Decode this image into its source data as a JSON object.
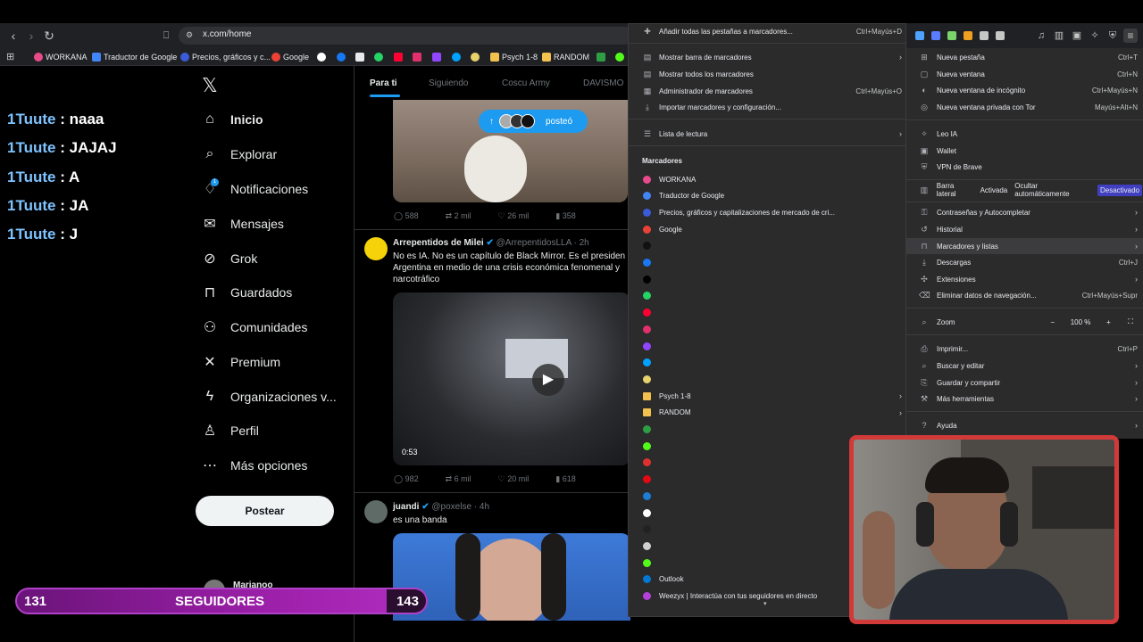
{
  "browser": {
    "url": "x.com/home",
    "bookmarks_bar": [
      {
        "label": "WORKANA",
        "color": "#e84b8a"
      },
      {
        "label": "Traductor de Google",
        "color": "#4285f4"
      },
      {
        "label": "Precios, gráficos y c...",
        "color": "#3b5bdb"
      },
      {
        "label": "Google",
        "color": "#ea4335"
      },
      {
        "label": "Psych 1-8",
        "color": "#f2c14e"
      },
      {
        "label": "RANDOM",
        "color": "#f2c14e"
      }
    ]
  },
  "chat": [
    {
      "user": "1Tuute",
      "sep": ":",
      "msg": "naaa"
    },
    {
      "user": "1Tuute",
      "sep": ":",
      "msg": "JAJAJ"
    },
    {
      "user": "1Tuute",
      "sep": ":",
      "msg": "A"
    },
    {
      "user": "1Tuute",
      "sep": ":",
      "msg": "JA"
    },
    {
      "user": "1Tuute",
      "sep": ":",
      "msg": "J"
    }
  ],
  "x_nav": {
    "logo": "𝕏",
    "items": [
      {
        "label": "Inicio",
        "icon": "home-icon"
      },
      {
        "label": "Explorar",
        "icon": "search-icon"
      },
      {
        "label": "Notificaciones",
        "icon": "bell-icon",
        "badge": "1"
      },
      {
        "label": "Mensajes",
        "icon": "mail-icon"
      },
      {
        "label": "Grok",
        "icon": "grok-icon"
      },
      {
        "label": "Guardados",
        "icon": "bookmark-icon"
      },
      {
        "label": "Comunidades",
        "icon": "people-icon"
      },
      {
        "label": "Premium",
        "icon": "x-icon"
      },
      {
        "label": "Organizaciones v...",
        "icon": "lightning-icon"
      },
      {
        "label": "Perfil",
        "icon": "person-icon"
      },
      {
        "label": "Más opciones",
        "icon": "more-icon"
      }
    ],
    "post_button": "Postear",
    "account_name": "Marianoo"
  },
  "feed": {
    "tabs": [
      "Para ti",
      "Siguiendo",
      "Coscu Army",
      "DAVISMO"
    ],
    "posted_pill": "posteó",
    "tweet1_actions": {
      "replies": "588",
      "retweets": "2 mil",
      "likes": "26 mil",
      "views": "358"
    },
    "tweet2": {
      "name": "Arrepentidos de Milei",
      "handle": "@ArrepentidosLLA · 2h",
      "text1": "No es IA. No es un capítulo de Black Mirror. Es el presiden",
      "text2": "Argentina en medio de una crisis económica fenomenal y",
      "text3": "narcotráfico",
      "duration": "0:53",
      "replies": "982",
      "retweets": "6 mil",
      "likes": "20 mil",
      "views": "618"
    },
    "tweet3": {
      "name": "juandi",
      "handle": "@poxelse · 4h",
      "text": "es una banda"
    }
  },
  "bookmarks_menu": {
    "top_items": [
      {
        "label": "Añadir todas las pestañas a marcadores...",
        "shortcut": "Ctrl+Mayús+D"
      },
      {
        "label": "Mostrar barra de marcadores",
        "arrow": true
      },
      {
        "label": "Mostrar todos los marcadores"
      },
      {
        "label": "Administrador de marcadores",
        "shortcut": "Ctrl+Mayús+O"
      },
      {
        "label": "Importar marcadores y configuración..."
      },
      {
        "label": "Lista de lectura",
        "arrow": true
      }
    ],
    "section_title": "Marcadores",
    "bookmarks": [
      {
        "label": "WORKANA",
        "color": "#e84b8a"
      },
      {
        "label": "Traductor de Google",
        "color": "#4285f4"
      },
      {
        "label": "Precios, gráficos y capitalizaciones de mercado de cri...",
        "color": "#3b5bdb"
      },
      {
        "label": "Google",
        "color": "#ea4335"
      },
      {
        "label": "",
        "color": "#111111"
      },
      {
        "label": "",
        "color": "#1877f2"
      },
      {
        "label": "",
        "color": "#000000"
      },
      {
        "label": "",
        "color": "#25d366"
      },
      {
        "label": "",
        "color": "#ff0033"
      },
      {
        "label": "",
        "color": "#e1306c"
      },
      {
        "label": "",
        "color": "#9146ff"
      },
      {
        "label": "",
        "color": "#00a2ff"
      },
      {
        "label": "",
        "color": "#e6d36b"
      },
      {
        "label": "Psych 1-8",
        "color": "#f2c14e",
        "folder": true
      },
      {
        "label": "RANDOM",
        "color": "#f2c14e",
        "folder": true
      },
      {
        "label": "",
        "color": "#2e9e44"
      },
      {
        "label": "",
        "color": "#53fc18"
      },
      {
        "label": "",
        "color": "#e03131"
      },
      {
        "label": "",
        "color": "#e50914"
      },
      {
        "label": "",
        "color": "#1c7ed6"
      },
      {
        "label": "",
        "color": "#ffffff"
      },
      {
        "label": "",
        "color": "#222222"
      },
      {
        "label": "",
        "color": "#d0d0d0"
      },
      {
        "label": "",
        "color": "#53fc18"
      },
      {
        "label": "Outlook",
        "color": "#0078d4"
      },
      {
        "label": "Weezyx | Interactúa con tus seguidores en directo",
        "color": "#b341d9"
      }
    ]
  },
  "main_menu": {
    "items": [
      {
        "label": "Nueva pestaña",
        "shortcut": "Ctrl+T",
        "icon": "new-tab-icon"
      },
      {
        "label": "Nueva ventana",
        "shortcut": "Ctrl+N",
        "icon": "window-icon"
      },
      {
        "label": "Nueva ventana de incógnito",
        "shortcut": "Ctrl+Mayús+N",
        "icon": "incognito-icon"
      },
      {
        "label": "Nueva ventana privada con Tor",
        "shortcut": "Mayús+Alt+N",
        "icon": "tor-icon"
      },
      {
        "label": "Leo IA",
        "icon": "leo-icon"
      },
      {
        "label": "Wallet",
        "icon": "wallet-icon"
      },
      {
        "label": "VPN de Brave",
        "icon": "vpn-icon"
      },
      {
        "label": "Contraseñas y Autocompletar",
        "arrow": true,
        "icon": "key-icon"
      },
      {
        "label": "Historial",
        "arrow": true,
        "icon": "history-icon"
      },
      {
        "label": "Marcadores y listas",
        "arrow": true,
        "icon": "bookmark-icon",
        "active": true
      },
      {
        "label": "Descargas",
        "shortcut": "Ctrl+J",
        "icon": "download-icon"
      },
      {
        "label": "Extensiones",
        "arrow": true,
        "icon": "puzzle-icon"
      },
      {
        "label": "Eliminar datos de navegación...",
        "shortcut": "Ctrl+Mayús+Supr",
        "icon": "trash-icon"
      },
      {
        "label": "Imprimir...",
        "shortcut": "Ctrl+P",
        "icon": "print-icon"
      },
      {
        "label": "Buscar y editar",
        "arrow": true,
        "icon": "search-icon"
      },
      {
        "label": "Guardar y compartir",
        "arrow": true,
        "icon": "save-icon"
      },
      {
        "label": "Más herramientas",
        "arrow": true,
        "icon": "tools-icon"
      },
      {
        "label": "Ayuda",
        "arrow": true,
        "icon": "help-icon"
      }
    ],
    "sidebar_row": {
      "label": "Barra lateral",
      "opt1": "Activada",
      "opt2": "Ocultar automáticamente",
      "opt3": "Desactivado"
    },
    "zoom": {
      "label": "Zoom",
      "minus": "−",
      "value": "100 %",
      "plus": "+"
    }
  },
  "followers": {
    "current": "131",
    "label": "SEGUIDORES",
    "goal": "143"
  }
}
